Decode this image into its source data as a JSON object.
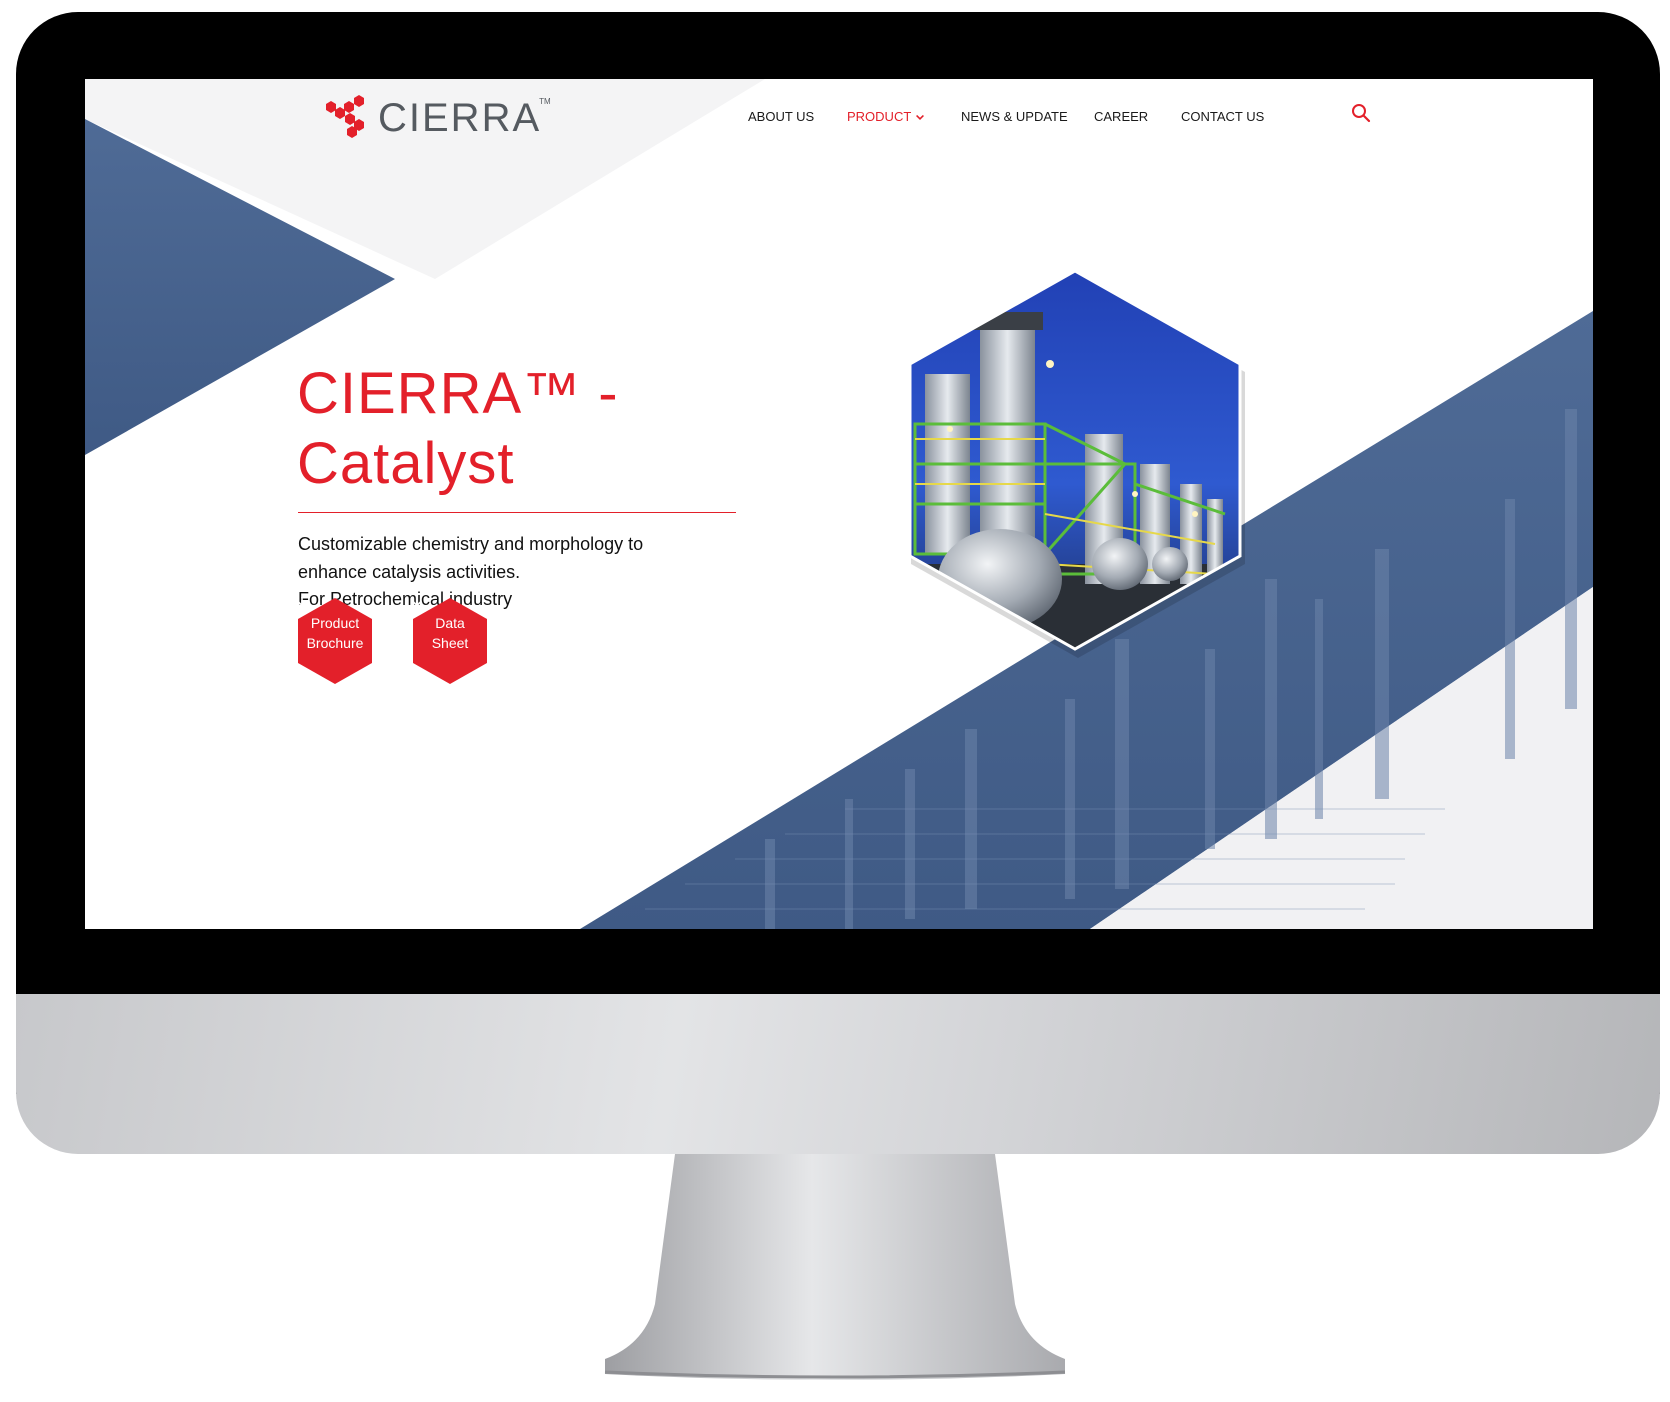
{
  "brand": {
    "name": "CIERRA",
    "tm": "TM"
  },
  "nav": {
    "items": [
      {
        "label": "ABOUT US"
      },
      {
        "label": "PRODUCT",
        "active": true
      },
      {
        "label": "NEWS & UPDATE"
      },
      {
        "label": "CAREER"
      },
      {
        "label": "CONTACT US"
      }
    ]
  },
  "hero": {
    "title_line1": "CIERRA™ -",
    "title_line2": "Catalyst",
    "desc_line1": "Customizable chemistry and morphology to",
    "desc_line2": "enhance catalysis activities.",
    "desc_line3": "For Petrochemical industry"
  },
  "buttons": {
    "brochure": {
      "line1": "Product",
      "line2": "Brochure"
    },
    "datasheet": {
      "line1": "Data",
      "line2": "Sheet"
    }
  },
  "icons": {
    "search": "search-icon",
    "download": "download-icon",
    "chevron": "chevron-down-icon",
    "logo": "molecule-logo-icon"
  },
  "colors": {
    "accent": "#e3202a",
    "blue": "#4f6b96",
    "text": "#111111",
    "light": "#f4f4f5"
  }
}
